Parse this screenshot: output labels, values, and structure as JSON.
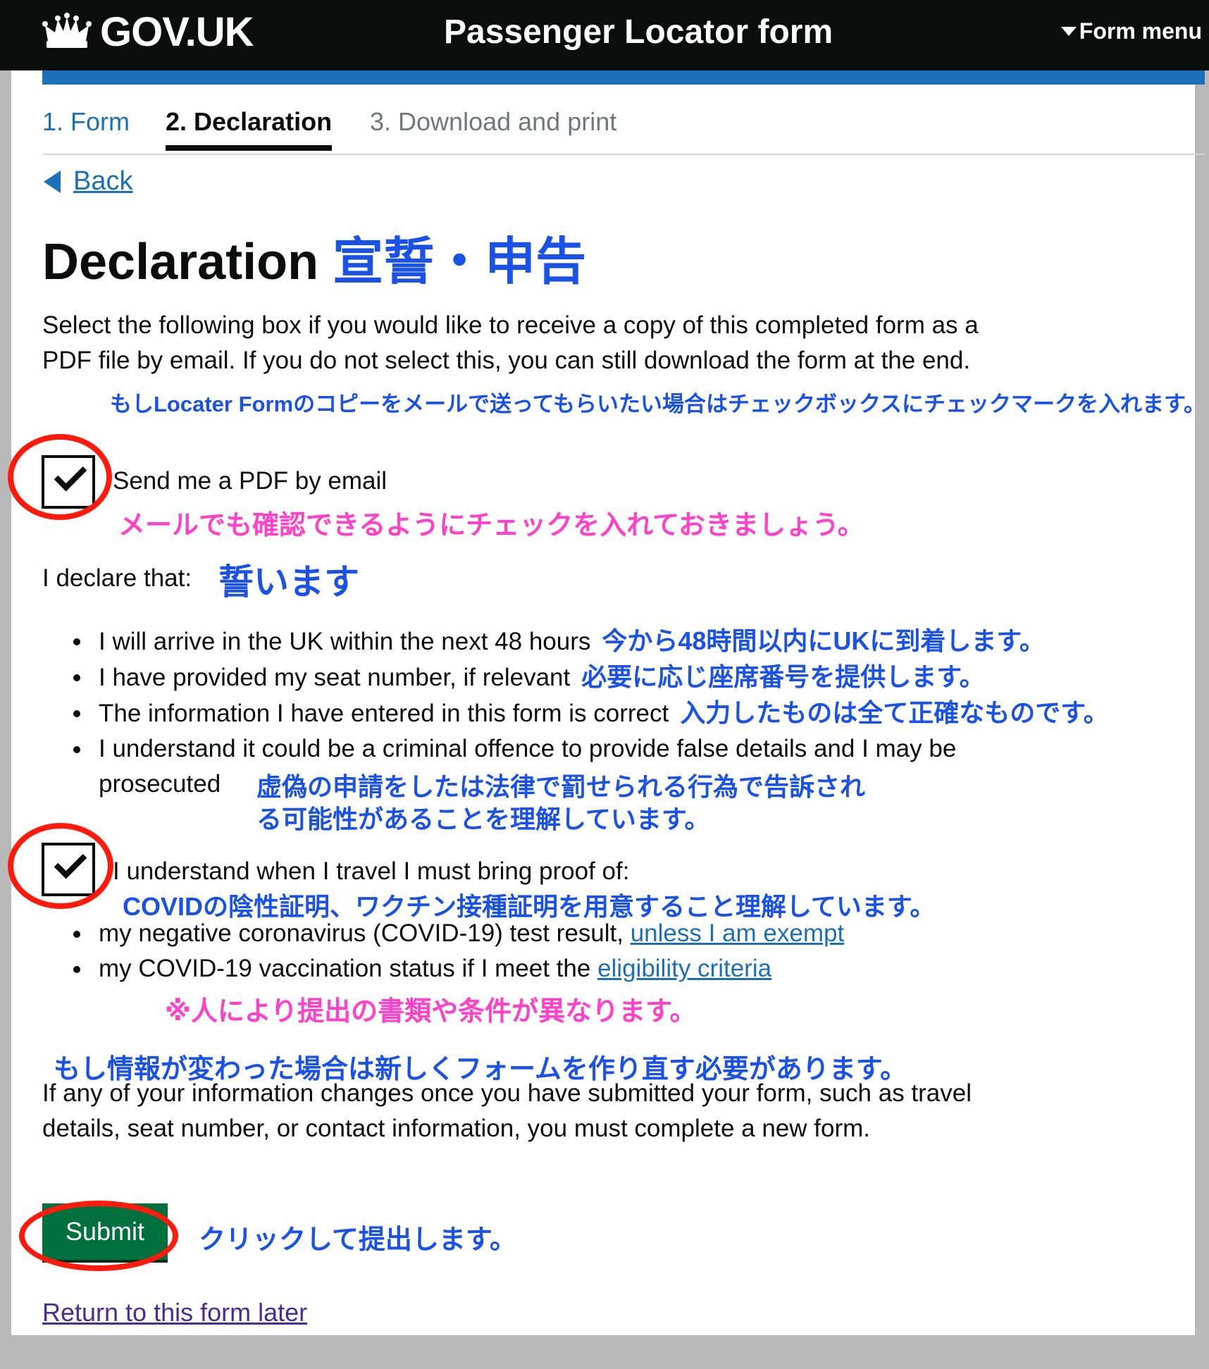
{
  "header": {
    "logo_text": "GOV.UK",
    "service_name": "Passenger Locator form",
    "menu_label": "Form menu"
  },
  "tabs": [
    {
      "label": "1. Form"
    },
    {
      "label": "2. Declaration"
    },
    {
      "label": "3. Download and print"
    }
  ],
  "back_label": "Back",
  "heading": {
    "en": "Declaration",
    "jp": "宣誓・申告"
  },
  "intro": {
    "text": "Select the following box if you would like to receive a copy of this completed form as a PDF file by email. If you do not select this, you can still download the form at the end.",
    "jp_note": "もしLocater Formのコピーをメールで送ってもらいたい場合はチェックボックスにチェックマークを入れます。"
  },
  "pdf_checkbox": {
    "label": "Send me a PDF by email",
    "jp_note": "メールでも確認できるようにチェックを入れておきましょう。"
  },
  "declare": {
    "label": "I declare that:",
    "jp": "誓います",
    "items": [
      {
        "text": "I will arrive in the UK within the next 48 hours",
        "jp": "今から48時間以内にUKに到着します。"
      },
      {
        "text": "I have provided my seat number, if relevant",
        "jp": "必要に応じ座席番号を提供します。"
      },
      {
        "text": "The information I have entered in this form is correct",
        "jp": "入力したものは全て正確なものです。"
      },
      {
        "text": "I understand it could be a criminal offence to provide false details and I may be prosecuted",
        "jp": ""
      }
    ],
    "offence_jp_1": "虚偽の申請をしたは法律で罰せられる行為で告訴され",
    "offence_jp_2": "る可能性があることを理解しています。"
  },
  "proof_checkbox": {
    "label": "I understand when I travel I must bring proof of:",
    "jp_note": "COVIDの陰性証明、ワクチン接種証明を用意すること理解しています。",
    "items": [
      {
        "text": "my negative coronavirus (COVID-19) test result,",
        "link": "unless I am exempt"
      },
      {
        "text": "my COVID-19 vaccination status if I meet the",
        "link": "eligibility criteria"
      }
    ],
    "jp_footnote": "※人により提出の書類や条件が異なります。"
  },
  "changes": {
    "jp_note": "もし情報が変わった場合は新しくフォームを作り直す必要があります。",
    "text": "If any of your information changes once you have submitted your form, such as travel details, seat number, or contact information, you must complete a new form."
  },
  "submit": {
    "label": "Submit",
    "jp_note": "クリックして提出します。"
  },
  "return_link": "Return to this form later",
  "colors": {
    "header_bg": "#0b0c0c",
    "brand_blue": "#1d70b8",
    "submit_green": "#00703c",
    "annotation_blue": "#1a52e8",
    "annotation_pink": "#ff40c8",
    "highlight_red": "#ff1a0c"
  },
  "icons": [
    "crown-icon",
    "caret-down-icon",
    "back-arrow-icon",
    "check-icon"
  ]
}
